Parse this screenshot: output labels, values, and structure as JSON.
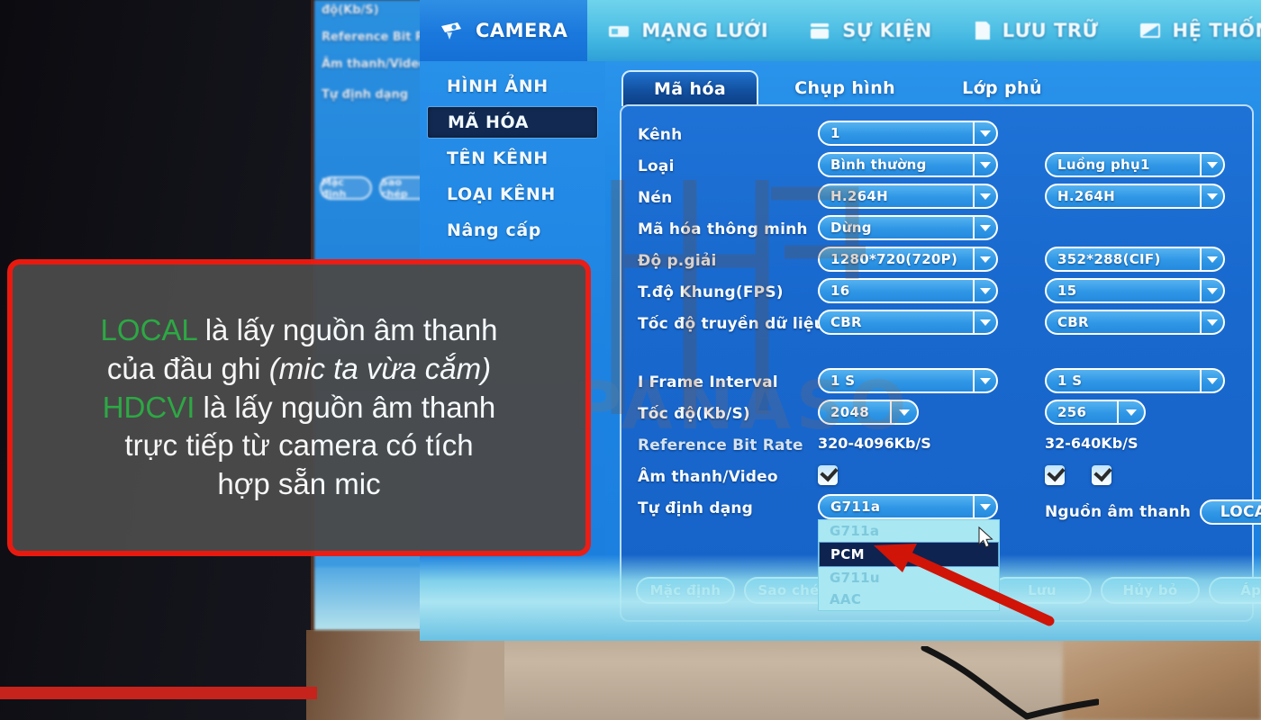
{
  "device": {
    "brand_watermark": "PANASO"
  },
  "topnav": {
    "items": [
      {
        "label": "CAMERA",
        "icon": "camera-icon",
        "active": true
      },
      {
        "label": "MẠNG LƯỚI",
        "icon": "network-icon",
        "active": false
      },
      {
        "label": "SỰ KIỆN",
        "icon": "event-icon",
        "active": false
      },
      {
        "label": "LƯU TRỮ",
        "icon": "storage-icon",
        "active": false
      },
      {
        "label": "HỆ THỐNG",
        "icon": "system-icon",
        "active": false
      }
    ]
  },
  "sidebar": {
    "items": [
      {
        "label": "HÌNH ẢNH",
        "selected": false
      },
      {
        "label": "MÃ HÓA",
        "selected": true
      },
      {
        "label": "TÊN KÊNH",
        "selected": false
      },
      {
        "label": "LOẠI KÊNH",
        "selected": false
      },
      {
        "label": "Nâng cấp",
        "selected": false
      }
    ]
  },
  "tabs": [
    {
      "label": "Mã hóa",
      "active": true
    },
    {
      "label": "Chụp hình",
      "active": false
    },
    {
      "label": "Lớp phủ",
      "active": false
    }
  ],
  "form": {
    "rows": [
      {
        "label": "Kênh",
        "main": "1",
        "sub": null
      },
      {
        "label": "Loại",
        "main": "Bình thường",
        "sub": "Luồng phụ1"
      },
      {
        "label": "Nén",
        "main": "H.264H",
        "sub": "H.264H"
      },
      {
        "label": "Mã hóa thông minh",
        "main": "Dừng",
        "sub": null
      },
      {
        "label": "Độ p.giải",
        "main": "1280*720(720P)",
        "sub": "352*288(CIF)"
      },
      {
        "label": "T.độ Khung(FPS)",
        "main": "16",
        "sub": "15"
      },
      {
        "label": "Tốc độ truyền dữ liệu",
        "main": "CBR",
        "sub": "CBR"
      }
    ],
    "rows2": [
      {
        "label": "I Frame Interval",
        "main": "1 S",
        "sub": "1 S"
      },
      {
        "label": "Tốc độ(Kb/S)",
        "main": "2048",
        "sub": "256"
      }
    ],
    "reference": {
      "label": "Reference Bit Rate",
      "main": "320-4096Kb/S",
      "sub": "32-640Kb/S"
    },
    "audio_video": {
      "label": "Âm thanh/Video",
      "main_checked": true,
      "sub_checked_1": true,
      "sub_checked_2": true
    },
    "format": {
      "label": "Tự định dạng",
      "value": "G711a",
      "options": [
        {
          "label": "G711a",
          "highlighted": false
        },
        {
          "label": "PCM",
          "highlighted": true
        },
        {
          "label": "G711u",
          "highlighted": false
        },
        {
          "label": "AAC",
          "highlighted": false
        }
      ]
    },
    "audio_source": {
      "label": "Nguồn âm thanh",
      "value": "LOCAL"
    }
  },
  "buttons": [
    {
      "label": "Mặc định",
      "align": "left"
    },
    {
      "label": "Sao chép",
      "align": "left"
    },
    {
      "label": "Lưu",
      "align": "right"
    },
    {
      "label": "Hủy bỏ",
      "align": "right"
    },
    {
      "label": "Áp d",
      "align": "right"
    }
  ],
  "ghost_panel": {
    "labels": [
      "độ(Kb/S)",
      "Reference Bit Rate",
      "Âm thanh/Video",
      "Tự định dạng"
    ],
    "buttons": [
      "Mặc định",
      "Sao chép"
    ]
  },
  "callout": {
    "line1_keyword": "LOCAL",
    "line1_rest": " là lấy nguồn âm thanh",
    "line2_a": "của đầu ghi ",
    "line2_italic": "(mic ta vừa cắm)",
    "line3_keyword": "HDCVI",
    "line3_rest": " là lấy nguồn âm thanh",
    "line4": "trực tiếp từ camera có tích",
    "line5": "hợp sẵn mic",
    "keyword_color": "#2fae46",
    "border_color": "#f01b10"
  }
}
